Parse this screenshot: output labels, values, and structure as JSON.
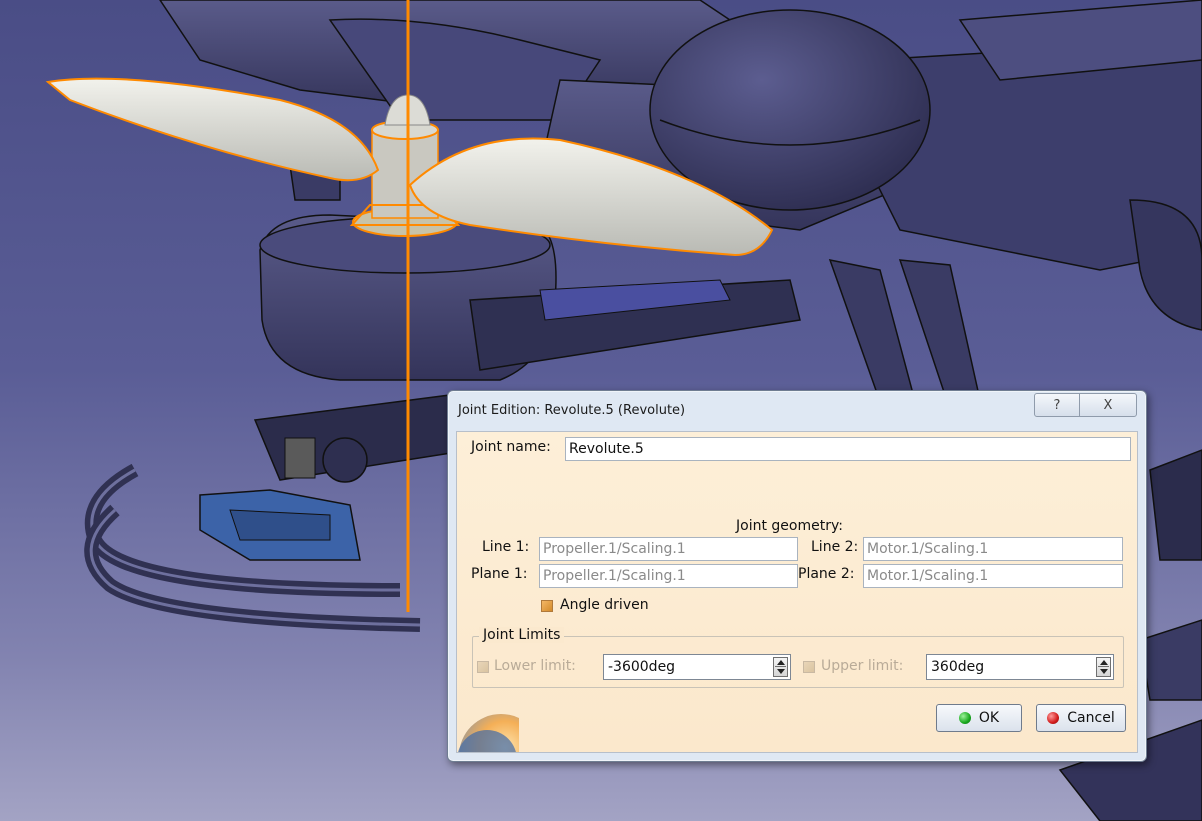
{
  "dialog": {
    "title": "Joint Edition: Revolute.5 (Revolute)",
    "help_glyph": "?",
    "close_glyph": "X"
  },
  "joint": {
    "name_label": "Joint name:",
    "name_value": "Revolute.5",
    "geometry_heading": "Joint geometry:",
    "line1_label": "Line 1:",
    "line1_value": "Propeller.1/Scaling.1",
    "line2_label": "Line 2:",
    "line2_value": "Motor.1/Scaling.1",
    "plane1_label": "Plane 1:",
    "plane1_value": "Propeller.1/Scaling.1",
    "plane2_label": "Plane 2:",
    "plane2_value": "Motor.1/Scaling.1",
    "angle_driven_label": "Angle driven",
    "angle_driven_checked": true
  },
  "limits": {
    "group_label": "Joint Limits",
    "lower_label": "Lower limit:",
    "lower_value": "-3600deg",
    "upper_label": "Upper limit:",
    "upper_value": "360deg"
  },
  "buttons": {
    "ok_label": "OK",
    "cancel_label": "Cancel"
  },
  "colors": {
    "highlight": "#ff8a00",
    "dialog_client": "#fdefd8"
  }
}
